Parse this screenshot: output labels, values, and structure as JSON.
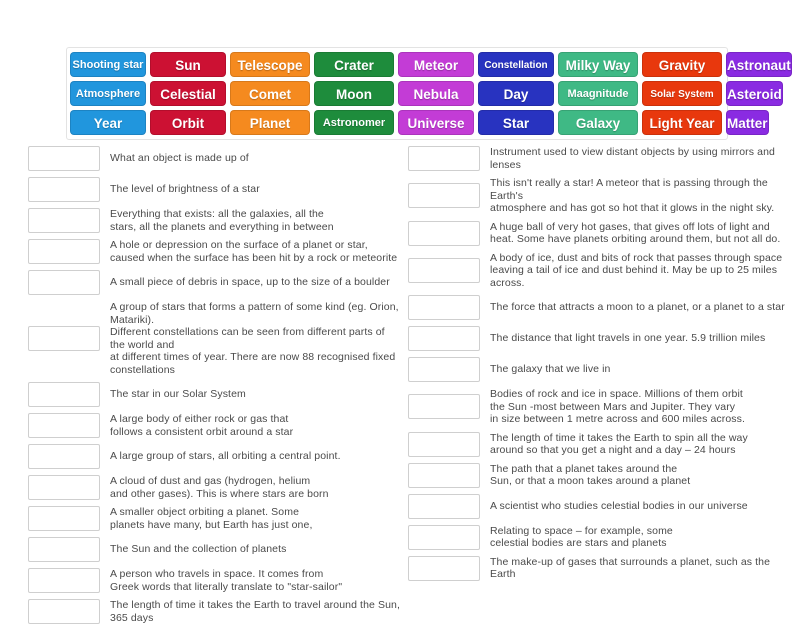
{
  "activity": {
    "type": "matching-tiles-activity",
    "title": "Space vocabulary matching"
  },
  "tile_bank": {
    "columns": 8,
    "rows": 3,
    "colors": {
      "blue_light": "#2196dd",
      "red": "#cc1133",
      "orange": "#f58a1f",
      "green": "#1e8c3c",
      "magenta": "#c33cd6",
      "royal_blue": "#2833c0",
      "sea_green": "#3fb985",
      "orange_red": "#e8380d",
      "purple": "#8a2be2"
    },
    "tiles": [
      [
        {
          "label": "Shooting star",
          "color": "#2196dd",
          "size": "sm"
        },
        {
          "label": "Sun",
          "color": "#cc1133",
          "size": "lg"
        },
        {
          "label": "Telescope",
          "color": "#f58a1f",
          "size": "md"
        },
        {
          "label": "Crater",
          "color": "#1e8c3c",
          "size": "md"
        },
        {
          "label": "Meteor",
          "color": "#c33cd6",
          "size": "md"
        },
        {
          "label": "Constellation",
          "color": "#2833c0",
          "size": "xs"
        },
        {
          "label": "Milky Way",
          "color": "#3fb985",
          "size": "md"
        },
        {
          "label": "Gravity",
          "color": "#e8380d",
          "size": "md"
        },
        {
          "label": "Astronaut",
          "color": "#8a2be2",
          "size": "md"
        }
      ],
      [
        {
          "label": "Atmosphere",
          "color": "#2196dd",
          "size": "sm"
        },
        {
          "label": "Celestial",
          "color": "#cc1133",
          "size": "md"
        },
        {
          "label": "Comet",
          "color": "#f58a1f",
          "size": "md"
        },
        {
          "label": "Moon",
          "color": "#1e8c3c",
          "size": "md"
        },
        {
          "label": "Nebula",
          "color": "#c33cd6",
          "size": "md"
        },
        {
          "label": "Day",
          "color": "#2833c0",
          "size": "md"
        },
        {
          "label": "Maagnitude",
          "color": "#3fb985",
          "size": "sm"
        },
        {
          "label": "Solar System",
          "color": "#e8380d",
          "size": "xs"
        },
        {
          "label": "Asteroid",
          "color": "#8a2be2",
          "size": "md"
        }
      ],
      [
        {
          "label": "Year",
          "color": "#2196dd",
          "size": "md"
        },
        {
          "label": "Orbit",
          "color": "#cc1133",
          "size": "md"
        },
        {
          "label": "Planet",
          "color": "#f58a1f",
          "size": "md"
        },
        {
          "label": "Astronomer",
          "color": "#1e8c3c",
          "size": "sm"
        },
        {
          "label": "Universe",
          "color": "#c33cd6",
          "size": "md"
        },
        {
          "label": "Star",
          "color": "#2833c0",
          "size": "md"
        },
        {
          "label": "Galaxy",
          "color": "#3fb985",
          "size": "md"
        },
        {
          "label": "Light Year",
          "color": "#e8380d",
          "size": "md"
        },
        {
          "label": "Matter",
          "color": "#8a2be2",
          "size": "md"
        }
      ]
    ]
  },
  "definitions_left": [
    "What an object is made up of",
    "The level of brightness of a star",
    "Everything that exists: all the galaxies, all the\nstars, all the planets and everything in between",
    "A hole or depression on the surface of a planet or star,\ncaused when the surface has been hit by a rock or meteorite",
    "A small piece of debris in space, up to the size of a boulder",
    "A group of stars that forms a pattern of some kind (eg. Orion, Matariki).\nDifferent constellations can be seen from different parts of the world and\nat different times of year. There are now 88 recognised fixed constellations",
    "The star in our Solar System",
    "A large body of either rock or gas that\nfollows a consistent orbit around a star",
    "A large group of stars, all orbiting a central point.",
    "A cloud of dust and gas (hydrogen, helium\nand other gases). This is where stars are born",
    "A smaller object orbiting a planet. Some\nplanets have many, but Earth has just one,",
    "The Sun and the collection of planets",
    "A person who travels in space. It comes from\nGreek words that literally translate to \"star-sailor\"",
    "The length of time it takes the Earth to travel around the Sun, 365 days"
  ],
  "definitions_right": [
    "Instrument used to view distant objects by using mirrors and lenses",
    "This isn't really a star! A meteor that is passing through the Earth's\natmosphere and has got so hot that it glows in the night sky.",
    "A huge ball of very hot gases, that gives off lots of light and\nheat. Some have planets orbiting around them, but not all do.",
    "A body of ice, dust and bits of rock that passes through space\nleaving a tail of ice and dust behind it. May be up to 25 miles across.",
    "The force that attracts a moon to a planet, or a planet to a star",
    "The distance that light travels in one year. 5.9 trillion miles",
    "The galaxy that we live in",
    "Bodies of rock and ice in space. Millions of them orbit\nthe Sun -most between Mars and Jupiter. They vary\nin size between 1 metre across and 600 miles across.",
    "The length of time it takes the Earth to spin all the way\naround so that you get a night and a day – 24 hours",
    "The path that a planet takes around the\nSun, or that a moon takes around a planet",
    "A scientist who studies celestial bodies in our universe",
    "Relating to space – for example, some\ncelestial bodies are stars and planets",
    "The make-up of gases that surrounds a planet, such as the Earth"
  ]
}
